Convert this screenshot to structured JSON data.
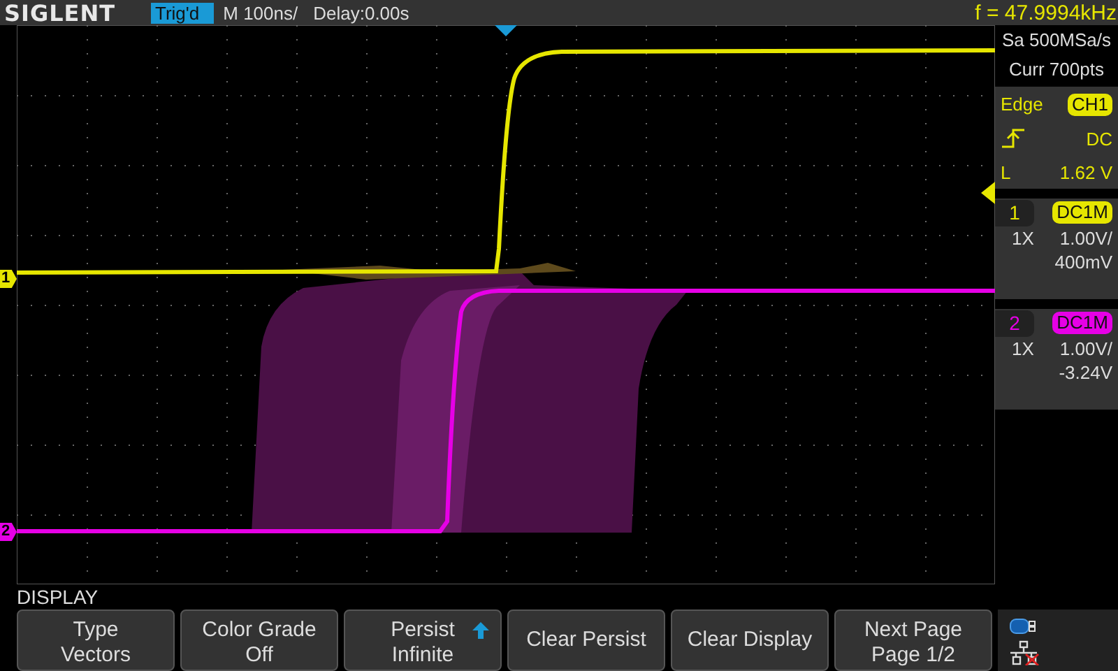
{
  "top_bar": {
    "logo": "SIGLENT",
    "trigger_status": "Trig'd",
    "timebase": "M 100ns/",
    "delay": "Delay:0.00s",
    "frequency": "f = 47.9994kHz"
  },
  "acquisition": {
    "sample_rate": "Sa 500MSa/s",
    "memory": "Curr 700pts"
  },
  "trigger": {
    "type": "Edge",
    "source": "CH1",
    "coupling": "DC",
    "level_label": "L",
    "level_value": "1.62 V"
  },
  "channels": [
    {
      "number": "1",
      "marker": "1",
      "coupling": "DC1M",
      "probe": "1X",
      "scale": "1.00V/",
      "offset": "400mV",
      "color": "#e6e600"
    },
    {
      "number": "2",
      "marker": "2",
      "coupling": "DC1M",
      "probe": "1X",
      "scale": "1.00V/",
      "offset": "-3.24V",
      "color": "#e600e6"
    }
  ],
  "menu": {
    "title": "DISPLAY",
    "buttons": [
      {
        "kind": "option",
        "label": "Type",
        "value": "Vectors",
        "arrow": false
      },
      {
        "kind": "option",
        "label": "Color Grade",
        "value": "Off",
        "arrow": false
      },
      {
        "kind": "option",
        "label": "Persist",
        "value": "Infinite",
        "arrow": true
      },
      {
        "kind": "action",
        "label": "Clear Persist",
        "arrow": false
      },
      {
        "kind": "action",
        "label": "Clear Display",
        "arrow": false
      },
      {
        "kind": "option",
        "label": "Next Page",
        "value": "Page 1/2",
        "arrow": false
      }
    ]
  }
}
